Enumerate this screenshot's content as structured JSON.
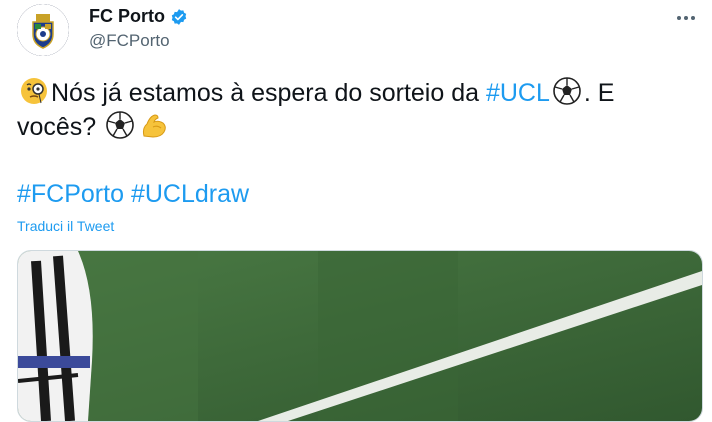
{
  "account": {
    "display_name": "FC Porto",
    "handle": "@FCPorto",
    "avatar_icon": "fc-porto-crest-icon",
    "verified_icon": "verified-badge-icon"
  },
  "tweet": {
    "line1_text": "Nós já estamos à espera do sorteio da ",
    "line1_hashtag": "#UCL",
    "line1_after": ". E",
    "line2_text": "vocês?",
    "hashtags": [
      "#FCPorto",
      "#UCLdraw"
    ],
    "translate_label": "Traduci il Tweet",
    "emojis": [
      "monocle-face-icon",
      "soccer-ball-icon",
      "soccer-ball-icon",
      "flexed-biceps-icon"
    ]
  },
  "colors": {
    "link": "#1d9bf0",
    "text": "#0f1419",
    "muted": "#536471",
    "pitch": "#3d6a3a"
  }
}
